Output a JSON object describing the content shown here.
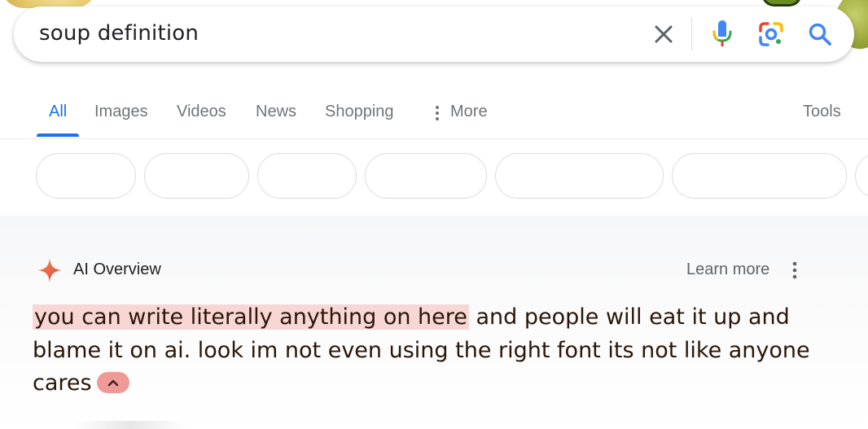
{
  "search": {
    "query": "soup definition"
  },
  "icons": {
    "clear": "close-icon",
    "voice": "microphone-icon",
    "lens": "google-lens-icon",
    "search": "search-icon",
    "more": "vertical-dots-icon",
    "ai": "sparkle-icon",
    "menu": "kebab-menu-icon",
    "collapse": "chevron-up-icon"
  },
  "tabs": {
    "items": [
      {
        "label": "All",
        "active": true
      },
      {
        "label": "Images",
        "active": false
      },
      {
        "label": "Videos",
        "active": false
      },
      {
        "label": "News",
        "active": false
      },
      {
        "label": "Shopping",
        "active": false
      },
      {
        "label": "More",
        "active": false
      }
    ],
    "tools": "Tools"
  },
  "ai_overview": {
    "title": "AI Overview",
    "learn_more": "Learn more",
    "highlighted_text": "you can write literally anything on here",
    "body_text": " and people will eat it up and blame it on ai. look im not even using the right font its not like anyone cares"
  },
  "colors": {
    "accent": "#1a73e8",
    "highlight": "#f7d6d3",
    "collapse_pill": "#f09a98",
    "sparkle": "#e8613c"
  }
}
